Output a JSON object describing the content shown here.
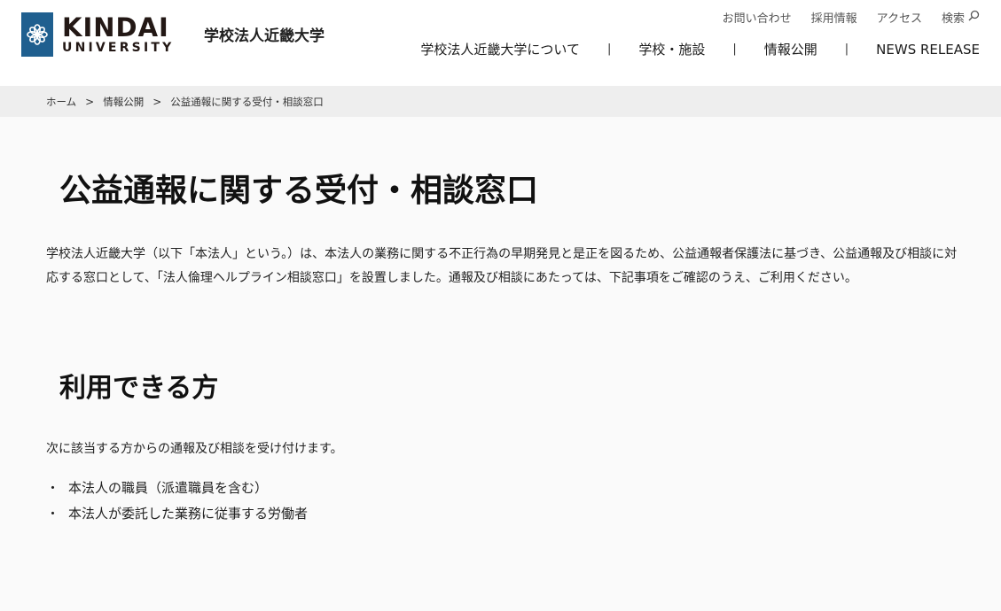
{
  "header": {
    "logo_main": "KINDAI",
    "logo_sub": "UNIVERSITY",
    "org_name": "学校法人近畿大学",
    "util_nav": {
      "contact": "お問い合わせ",
      "recruit": "採用情報",
      "access": "アクセス",
      "search": "検索"
    },
    "main_nav": [
      {
        "label": "学校法人近畿大学について"
      },
      {
        "label": "学校・施設"
      },
      {
        "label": "情報公開"
      },
      {
        "label": "NEWS RELEASE"
      }
    ],
    "nav_separator": "|"
  },
  "breadcrumb": {
    "items": [
      "ホーム",
      "情報公開",
      "公益通報に関する受付・相談窓口"
    ],
    "separator": ">"
  },
  "main": {
    "title": "公益通報に関する受付・相談窓口",
    "intro": "学校法人近畿大学（以下「本法人」という。）は、本法人の業務に関する不正行為の早期発見と是正を図るため、公益通報者保護法に基づき、公益通報及び相談に対応する窓口として、「法人倫理ヘルプライン相談窓口」を設置しました。通報及び相談にあたっては、下記事項をご確認のうえ、ご利用ください。",
    "section1": {
      "title": "利用できる方",
      "lead": "次に該当する方からの通報及び相談を受け付けます。",
      "bullet": "・",
      "items": [
        "本法人の職員（派遣職員を含む）",
        "本法人が委託した業務に従事する労働者"
      ]
    }
  },
  "colors": {
    "logo_mark": "#1f5f8f",
    "page_bg": "#fafafa",
    "breadcrumb_bg": "#eeeeee"
  },
  "icons": {
    "logo": "flower-logo-icon",
    "search": "search-icon"
  }
}
